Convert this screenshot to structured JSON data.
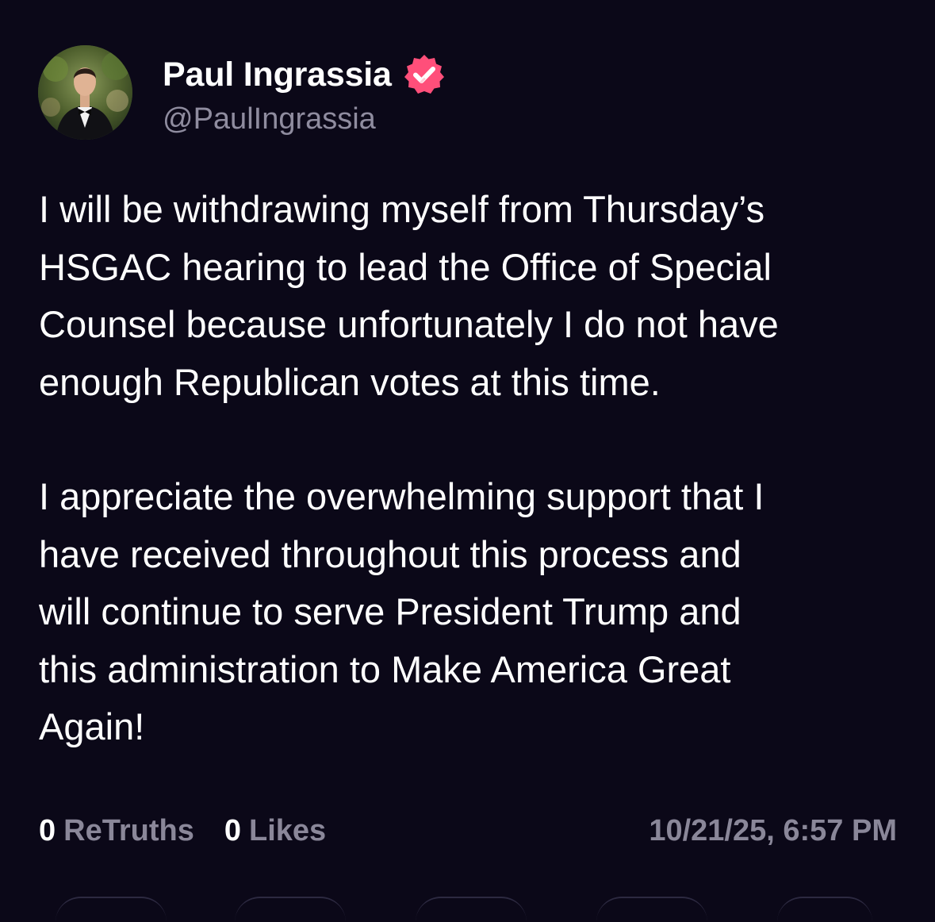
{
  "author": {
    "display_name": "Paul Ingrassia",
    "handle": "@PaulIngrassia",
    "verified_icon": "verified-badge-icon",
    "badge_color": "#ff4f7a"
  },
  "post": {
    "paragraphs": [
      {
        "lines": [
          "I will be withdrawing myself from Thursday’s",
          "HSGAC hearing to lead the Office of Special",
          "Counsel because unfortunately I do not have",
          "enough Republican votes at this time."
        ]
      },
      {
        "lines": [
          "I appreciate the overwhelming support that I",
          "have received throughout this process and",
          "will continue to serve President Trump and",
          "this administration to Make America Great",
          "Again!"
        ]
      }
    ]
  },
  "stats": {
    "retruths_count": "0",
    "retruths_label": "ReTruths",
    "likes_count": "0",
    "likes_label": "Likes"
  },
  "timestamp": "10/21/25, 6:57 PM",
  "colors": {
    "background": "#0b0818",
    "text_primary": "#ffffff",
    "text_secondary": "#8a8799"
  }
}
